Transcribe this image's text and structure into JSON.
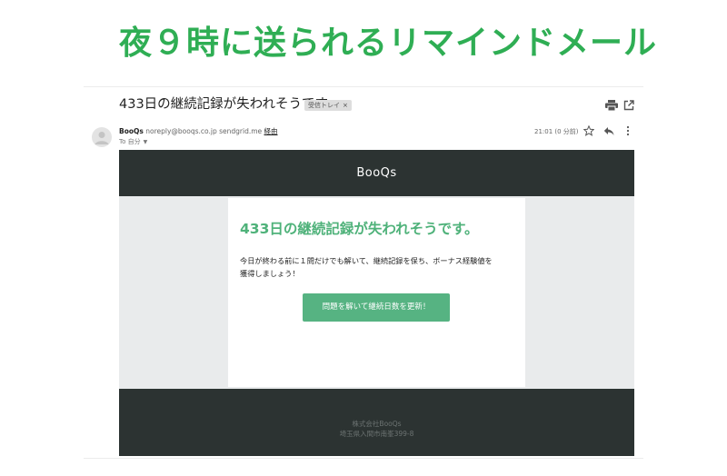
{
  "headline": "夜９時に送られるリマインドメール",
  "email": {
    "subject": "433日の継続記録が失われそうです。",
    "label": "受信トレイ",
    "label_close": "×",
    "sender_name": "BooQs",
    "sender_address": "noreply@booqs.co.jp sendgrid.me",
    "sender_via": "経由",
    "to": "To 自分",
    "time": "21:01 (0 分前)",
    "icons": [
      "print-icon",
      "open-in-new-window-icon",
      "avatar-icon",
      "star-icon",
      "reply-icon",
      "more-vert-icon",
      "chevron-down-icon"
    ]
  },
  "content": {
    "brand": "BooQs",
    "title": "433日の継続記録が失われそうです。",
    "body_line1": "今日が終わる前に１問だけでも解いて、継続記録を保ち、ボーナス経験値を",
    "body_line2": "獲得しましょう！",
    "cta": "問題を解いて継続日数を更新！",
    "footer_company": "株式会社BooQs",
    "footer_address": "埼玉県入間市南峯399-8"
  },
  "colors": {
    "headline": "#2fae54",
    "title": "#4fb27a",
    "button": "#56b382",
    "dark_band": "#2c3332",
    "outer_bg": "#e9ebec"
  }
}
